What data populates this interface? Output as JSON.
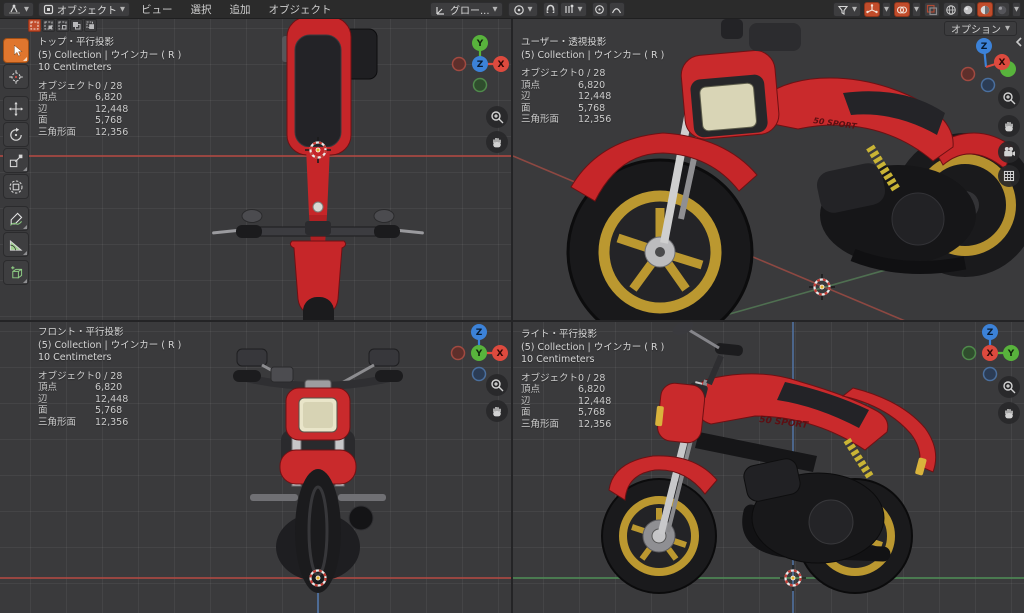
{
  "header": {
    "editor_icon": "3d-viewport-editor-icon",
    "mode": {
      "label": "オブジェクト",
      "icon": "object-mode-icon"
    },
    "menus": [
      "ビュー",
      "選択",
      "追加",
      "オブジェクト"
    ],
    "center": {
      "orientation_label": "グロー...",
      "orientation_icon": "transform-orientation-icon",
      "pivot_icon": "pivot-point-icon",
      "snap_icon": "snap-magnet-icon",
      "snap_with_icon": "snap-target-icon",
      "proportional_icon": "proportional-editing-icon",
      "falloff_icon": "proportional-falloff-icon"
    },
    "right_icons": [
      "filter-funnel-icon",
      "gizmo-icon",
      "overlays-icon",
      "xray-icon",
      "shading-wireframe-icon",
      "shading-solid-icon",
      "shading-material-icon",
      "shading-rendered-icon"
    ]
  },
  "tool_settings": {
    "options_label": "オプション",
    "select_mode_icons": [
      "select-set",
      "select-extend",
      "select-subtract",
      "select-invert",
      "select-intersect"
    ]
  },
  "toolbar": {
    "tools": [
      "select-box",
      "cursor",
      "move",
      "rotate",
      "scale",
      "transform",
      "annotate",
      "measure",
      "add-cube"
    ],
    "active_tool": "select-box"
  },
  "viewports": [
    {
      "name": "top",
      "label": "トップ・平行投影",
      "collection": "(5) Collection | ウインカー ( R )",
      "scale": "10 Centimeters"
    },
    {
      "name": "user",
      "label": "ユーザー・透視投影",
      "collection": "(5) Collection | ウインカー ( R )"
    },
    {
      "name": "front",
      "label": "フロント・平行投影",
      "collection": "(5) Collection | ウインカー ( R )",
      "scale": "10 Centimeters"
    },
    {
      "name": "right",
      "label": "ライト・平行投影",
      "collection": "(5) Collection | ウインカー ( R )",
      "scale": "10 Centimeters"
    }
  ],
  "stats": {
    "rows": [
      {
        "label": "オブジェクト",
        "value": "0 / 28"
      },
      {
        "label": "頂点",
        "value": "6,820"
      },
      {
        "label": "辺",
        "value": "12,448"
      },
      {
        "label": "面",
        "value": "5,768"
      },
      {
        "label": "三角形面",
        "value": "12,356"
      }
    ]
  },
  "axes": {
    "x": "X",
    "y": "Y",
    "z": "Z"
  },
  "bike": {
    "decal": "50 SPORT",
    "body_red": "#c92a2c",
    "rim_gold": "#bb9830",
    "tire": "#1a1a1c"
  },
  "colors": {
    "accent_orange": "#e0762e",
    "toggle_orange": "#c14c2b",
    "axis_x": "#dd4a3e",
    "axis_y": "#58b33c",
    "axis_z": "#3c82d8",
    "viewport_bg": "#3a3a3c",
    "header_bg": "#2b2b2b"
  }
}
